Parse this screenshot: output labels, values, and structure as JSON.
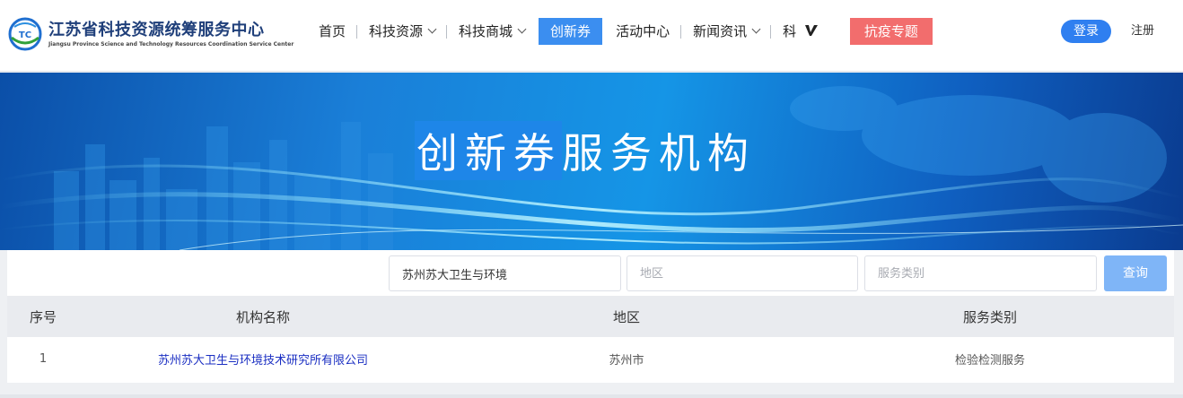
{
  "header": {
    "logo_cn": "江苏省科技资源统筹服务中心",
    "logo_en": "Jiangsu Province Science and Technology Resources Coordination Service Center",
    "logo_mark_text": "TC"
  },
  "nav": {
    "items": [
      {
        "label": "首页"
      },
      {
        "label": "科技资源"
      },
      {
        "label": "科技商城"
      },
      {
        "label": "创新券"
      },
      {
        "label": "活动中心"
      },
      {
        "label": "新闻资讯"
      },
      {
        "label": "科"
      },
      {
        "label": "抗疫专题"
      }
    ],
    "login": "登录",
    "register": "注册"
  },
  "banner": {
    "title_highlight": "创新券",
    "title_rest": "服务机构"
  },
  "search": {
    "org_value": "苏州苏大卫生与环境",
    "area_placeholder": "地区",
    "type_placeholder": "服务类别",
    "query_label": "查询"
  },
  "table": {
    "headers": [
      "序号",
      "机构名称",
      "地区",
      "服务类别"
    ],
    "rows": [
      {
        "idx": "1",
        "name": "苏州苏大卫生与环境技术研究所有限公司",
        "area": "苏州市",
        "type": "检验检测服务"
      }
    ]
  },
  "colors": {
    "accent": "#3b8ef0",
    "epidemic": "#f26d6d",
    "link": "#1a2ec2"
  }
}
